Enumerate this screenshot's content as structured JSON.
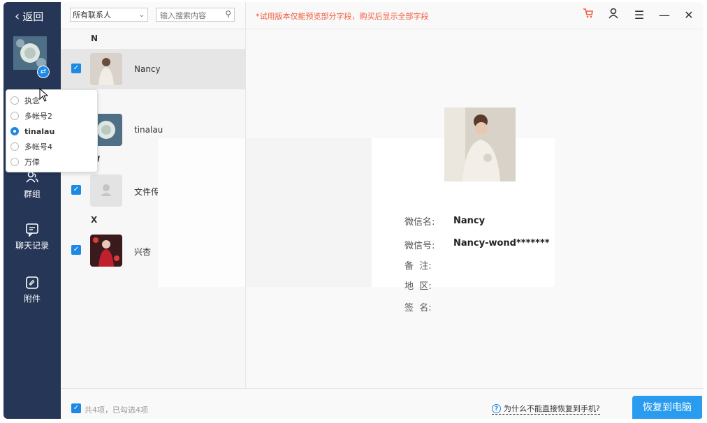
{
  "sidebar": {
    "back_label": "返回",
    "nav": [
      {
        "label": "群组",
        "icon": "group-icon"
      },
      {
        "label": "聊天记录",
        "icon": "chat-record-icon"
      },
      {
        "label": "附件",
        "icon": "attachment-icon"
      }
    ]
  },
  "account_menu": {
    "items": [
      {
        "label": "执念",
        "selected": false
      },
      {
        "label": "多帐号2",
        "selected": false
      },
      {
        "label": "tinalau",
        "selected": true
      },
      {
        "label": "多帐号4",
        "selected": false
      },
      {
        "label": "万倖",
        "selected": false
      }
    ]
  },
  "list": {
    "filter_value": "所有联系人",
    "search_placeholder": "输入搜索内容",
    "groups": [
      {
        "letter": "N",
        "contacts": [
          "Nancy",
          "tinalau"
        ]
      },
      {
        "letter": "W",
        "contacts": [
          "文件传输助手"
        ]
      },
      {
        "letter": "X",
        "contacts": [
          "兴杏"
        ]
      }
    ]
  },
  "detail": {
    "notice": "*试用版本仅能预览部分字段，购买后显示全部字段",
    "fields": [
      {
        "label": "微信名:",
        "value": "Nancy"
      },
      {
        "label": "微信号:",
        "value": "Nancy-wond*******"
      },
      {
        "label": "备  注:",
        "value": ""
      },
      {
        "label": "地  区:",
        "value": ""
      },
      {
        "label": "签  名:",
        "value": ""
      }
    ]
  },
  "footer": {
    "count_text": "共4项，已勾选4项",
    "help_link": "为什么不能直接恢复到手机?",
    "restore_button": "恢复到电脑"
  },
  "colors": {
    "sidebar_bg": "#253657",
    "accent": "#1e88e5",
    "notice": "#f05a3a"
  }
}
